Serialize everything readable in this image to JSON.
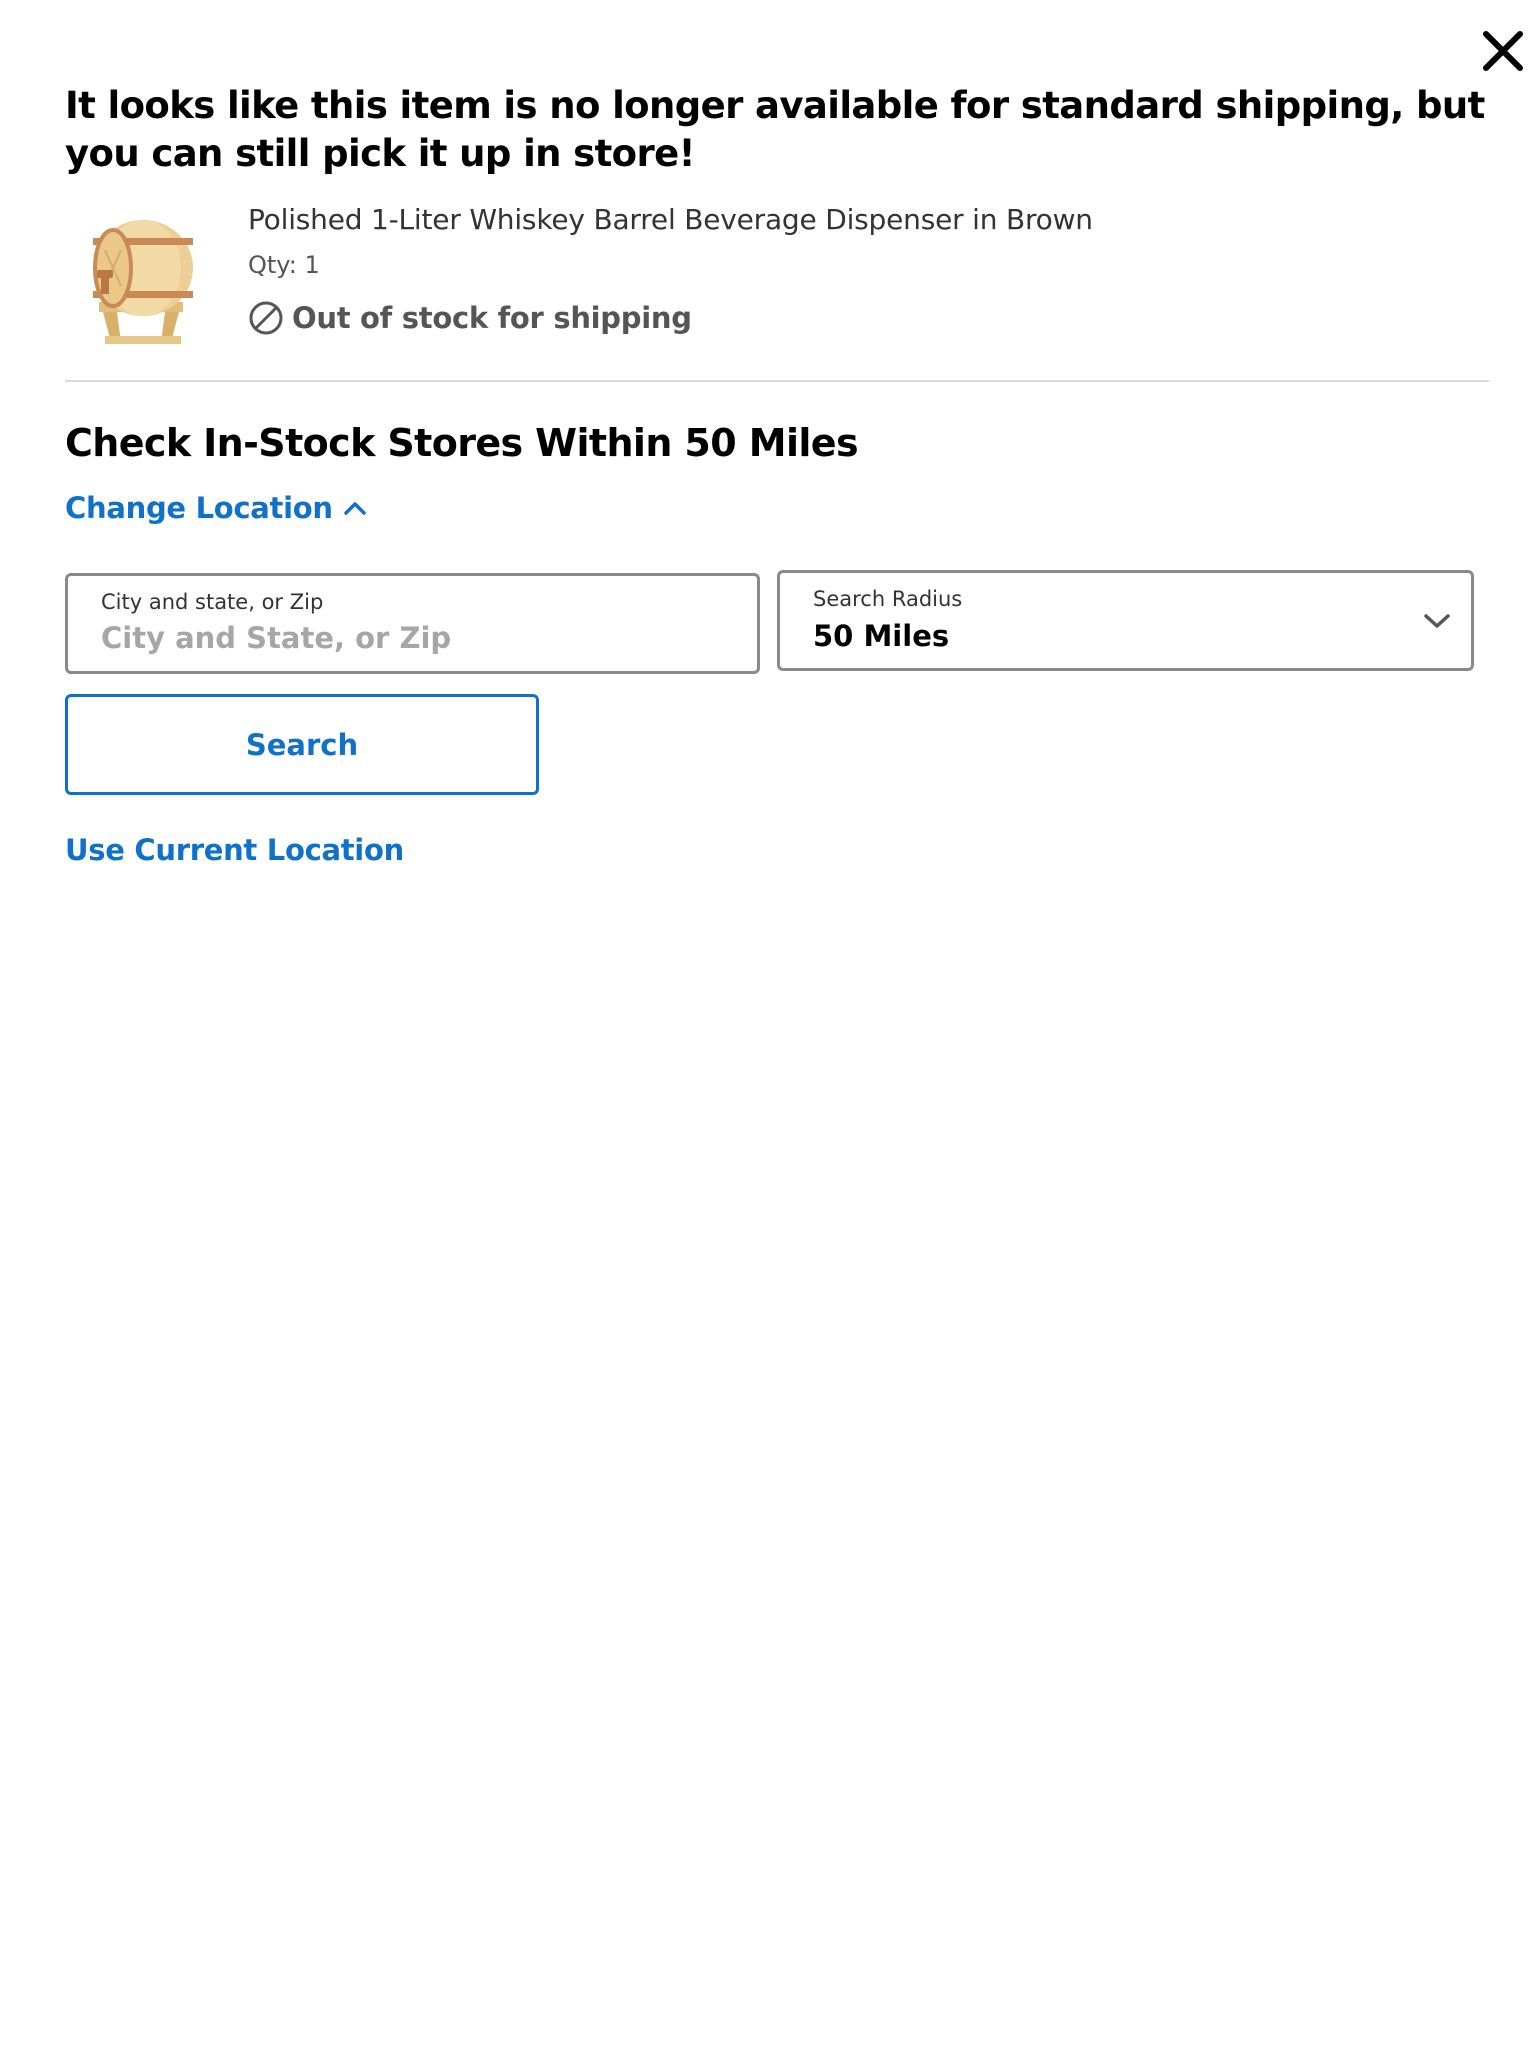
{
  "modal": {
    "close_icon": "close-icon",
    "headline": "It looks like this item is no longer available for standard shipping, but you can still pick it up in store!"
  },
  "product": {
    "image": "whiskey-barrel-dispenser-image",
    "name": "Polished 1-Liter Whiskey Barrel Beverage Dispenser in Brown",
    "qty": "Qty: 1",
    "stock_icon": "ban-icon",
    "stock_status": "Out of stock for shipping"
  },
  "store_search": {
    "title": "Check In-Stock Stores Within 50 Miles",
    "change_location_label": "Change Location",
    "change_location_icon": "chevron-up-icon",
    "city_field": {
      "label": "City and state, or Zip",
      "placeholder": "City and State, or Zip",
      "value": ""
    },
    "radius_field": {
      "label": "Search Radius",
      "value": "50 Miles",
      "icon": "chevron-down-icon"
    },
    "search_button_label": "Search",
    "use_current_location_label": "Use Current Location"
  },
  "colors": {
    "accent": "#0f72c8",
    "text": "#000000",
    "muted": "#555555",
    "border": "#8a8a8a",
    "divider": "#d9d9d9",
    "placeholder": "#a6a6a6"
  }
}
